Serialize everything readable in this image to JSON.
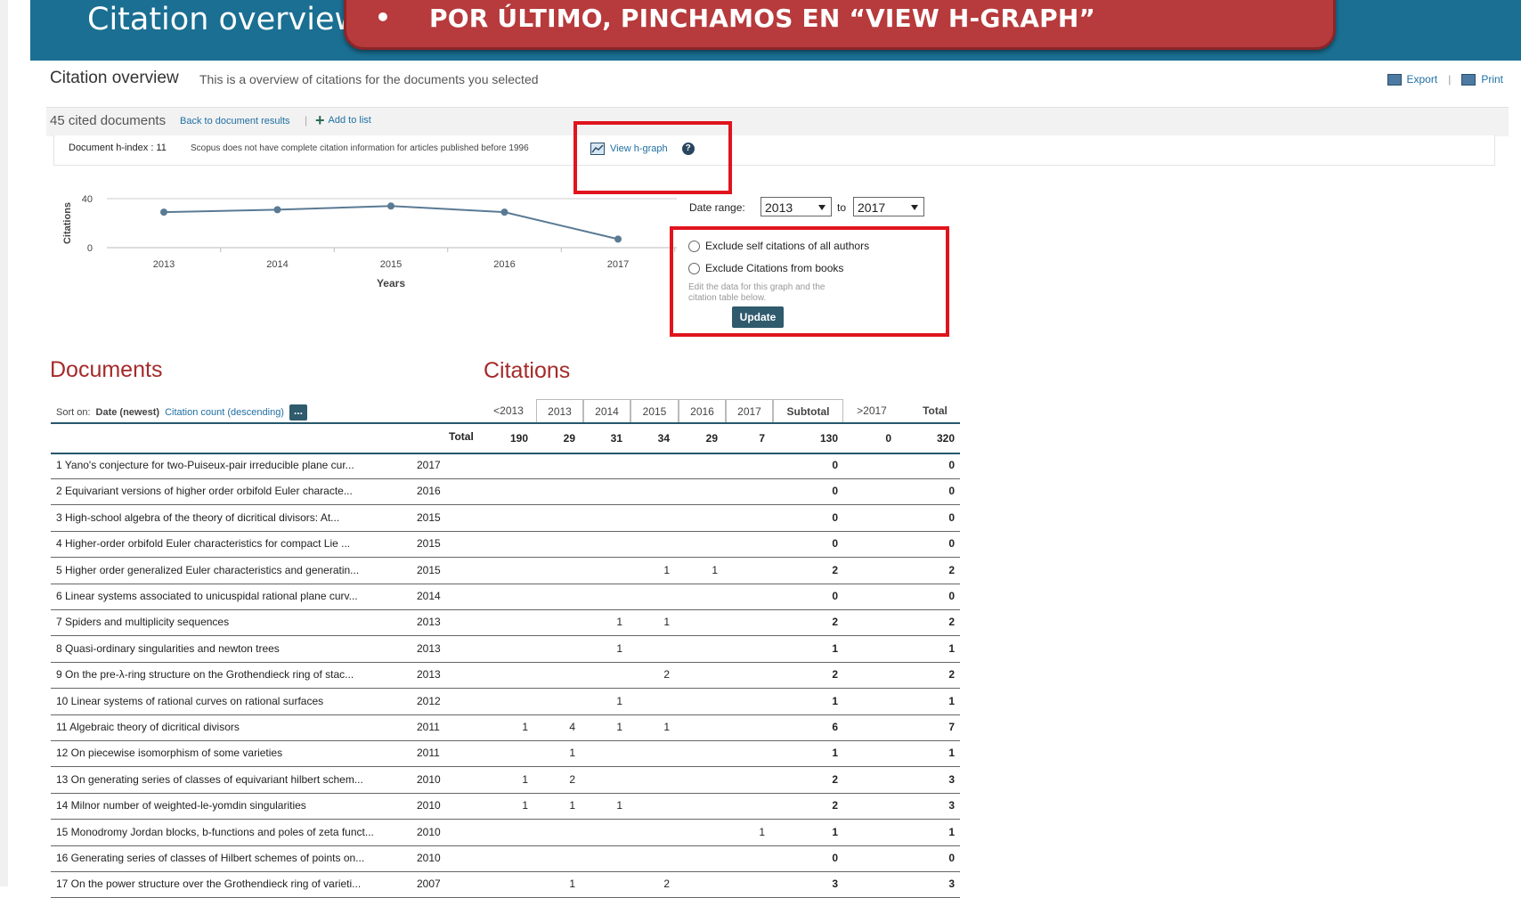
{
  "banner": {
    "title": "Citation overview",
    "callout_bullet": "•",
    "callout_text": "POR ÚLTIMO, PINCHAMOS EN “VIEW H-GRAPH”"
  },
  "header": {
    "title": "Citation overview",
    "subtitle": "This is a overview of citations for the documents you selected",
    "export_label": "Export",
    "print_label": "Print",
    "separator": "|"
  },
  "toolbar": {
    "cited_count": "45 cited documents",
    "back_label": "Back to document results",
    "separator": "|",
    "add_label": "Add to list"
  },
  "hindex": {
    "label": "Document h-index : 11",
    "note": "Scopus does not have complete citation information for articles published before 1996",
    "view_hgraph": "View h-graph",
    "help": "?"
  },
  "chart_data": {
    "type": "line",
    "x": [
      "2013",
      "2014",
      "2015",
      "2016",
      "2017"
    ],
    "series": [
      {
        "values": [
          29,
          31,
          34,
          29,
          7
        ]
      }
    ],
    "ylabel": "Citations",
    "xlabel": "Years",
    "y_ticks": [
      "40",
      "0"
    ],
    "ylim": [
      0,
      40
    ],
    "grid": false,
    "color": "#5a7a94"
  },
  "filters": {
    "date_range_label": "Date range:",
    "from": "2013",
    "to_label": "to",
    "to": "2017",
    "exclude_self": "Exclude self citations of all authors",
    "exclude_books": "Exclude Citations from books",
    "edit_note": "Edit the data for this graph and the citation table below.",
    "update": "Update"
  },
  "sections": {
    "documents": "Documents",
    "citations": "Citations"
  },
  "sort": {
    "label": "Sort on:",
    "active": "Date (newest)",
    "link": "Citation count (descending)",
    "more": "..."
  },
  "table": {
    "year_headers": [
      "<2013",
      "2013",
      "2014",
      "2015",
      "2016",
      "2017",
      "Subtotal",
      ">2017",
      "Total"
    ],
    "totals": {
      "label": "Total",
      "values": [
        "190",
        "29",
        "31",
        "34",
        "29",
        "7",
        "130",
        "0",
        "320"
      ]
    },
    "rows": [
      {
        "n": "1",
        "title": "Yano's conjecture for two-Puiseux-pair irreducible plane cur...",
        "year": "2017",
        "c": [
          "",
          "",
          "",
          "",
          "",
          "",
          "0",
          "",
          "0"
        ]
      },
      {
        "n": "2",
        "title": "Equivariant versions of higher order orbifold Euler characte...",
        "year": "2016",
        "c": [
          "",
          "",
          "",
          "",
          "",
          "",
          "0",
          "",
          "0"
        ]
      },
      {
        "n": "3",
        "title": "High-school algebra of the theory of dicritical divisors: At...",
        "year": "2015",
        "c": [
          "",
          "",
          "",
          "",
          "",
          "",
          "0",
          "",
          "0"
        ]
      },
      {
        "n": "4",
        "title": "Higher-order orbifold Euler characteristics for compact Lie ...",
        "year": "2015",
        "c": [
          "",
          "",
          "",
          "",
          "",
          "",
          "0",
          "",
          "0"
        ]
      },
      {
        "n": "5",
        "title": "Higher order generalized Euler characteristics and generatin...",
        "year": "2015",
        "c": [
          "",
          "",
          "",
          "1",
          "1",
          "",
          "2",
          "",
          "2"
        ]
      },
      {
        "n": "6",
        "title": "Linear systems associated to unicuspidal rational plane curv...",
        "year": "2014",
        "c": [
          "",
          "",
          "",
          "",
          "",
          "",
          "0",
          "",
          "0"
        ]
      },
      {
        "n": "7",
        "title": "Spiders and multiplicity sequences",
        "year": "2013",
        "c": [
          "",
          "",
          "1",
          "1",
          "",
          "",
          "2",
          "",
          "2"
        ]
      },
      {
        "n": "8",
        "title": "Quasi-ordinary singularities and newton trees",
        "year": "2013",
        "c": [
          "",
          "",
          "1",
          "",
          "",
          "",
          "1",
          "",
          "1"
        ]
      },
      {
        "n": "9",
        "title": "On the pre-λ-ring structure on the Grothendieck ring of stac...",
        "year": "2013",
        "c": [
          "",
          "",
          "",
          "2",
          "",
          "",
          "2",
          "",
          "2"
        ]
      },
      {
        "n": "10",
        "title": "Linear systems of rational curves on rational surfaces",
        "year": "2012",
        "c": [
          "",
          "",
          "1",
          "",
          "",
          "",
          "1",
          "",
          "1"
        ]
      },
      {
        "n": "11",
        "title": "Algebraic theory of dicritical divisors",
        "year": "2011",
        "c": [
          "1",
          "4",
          "1",
          "1",
          "",
          "",
          "6",
          "",
          "7"
        ]
      },
      {
        "n": "12",
        "title": "On piecewise isomorphism of some varieties",
        "year": "2011",
        "c": [
          "",
          "1",
          "",
          "",
          "",
          "",
          "1",
          "",
          "1"
        ]
      },
      {
        "n": "13",
        "title": "On generating series of classes of equivariant hilbert schem...",
        "year": "2010",
        "c": [
          "1",
          "2",
          "",
          "",
          "",
          "",
          "2",
          "",
          "3"
        ]
      },
      {
        "n": "14",
        "title": "Milnor number of weighted-le-yomdin singularities",
        "year": "2010",
        "c": [
          "1",
          "1",
          "1",
          "",
          "",
          "",
          "2",
          "",
          "3"
        ]
      },
      {
        "n": "15",
        "title": "Monodromy Jordan blocks, b-functions and poles of zeta funct...",
        "year": "2010",
        "c": [
          "",
          "",
          "",
          "",
          "",
          "1",
          "1",
          "",
          "1"
        ]
      },
      {
        "n": "16",
        "title": "Generating series of classes of Hilbert schemes of points on...",
        "year": "2010",
        "c": [
          "",
          "",
          "",
          "",
          "",
          "",
          "0",
          "",
          "0"
        ]
      },
      {
        "n": "17",
        "title": "On the power structure over the Grothendieck ring of varieti...",
        "year": "2007",
        "c": [
          "",
          "1",
          "",
          "2",
          "",
          "",
          "3",
          "",
          "3"
        ]
      }
    ]
  }
}
